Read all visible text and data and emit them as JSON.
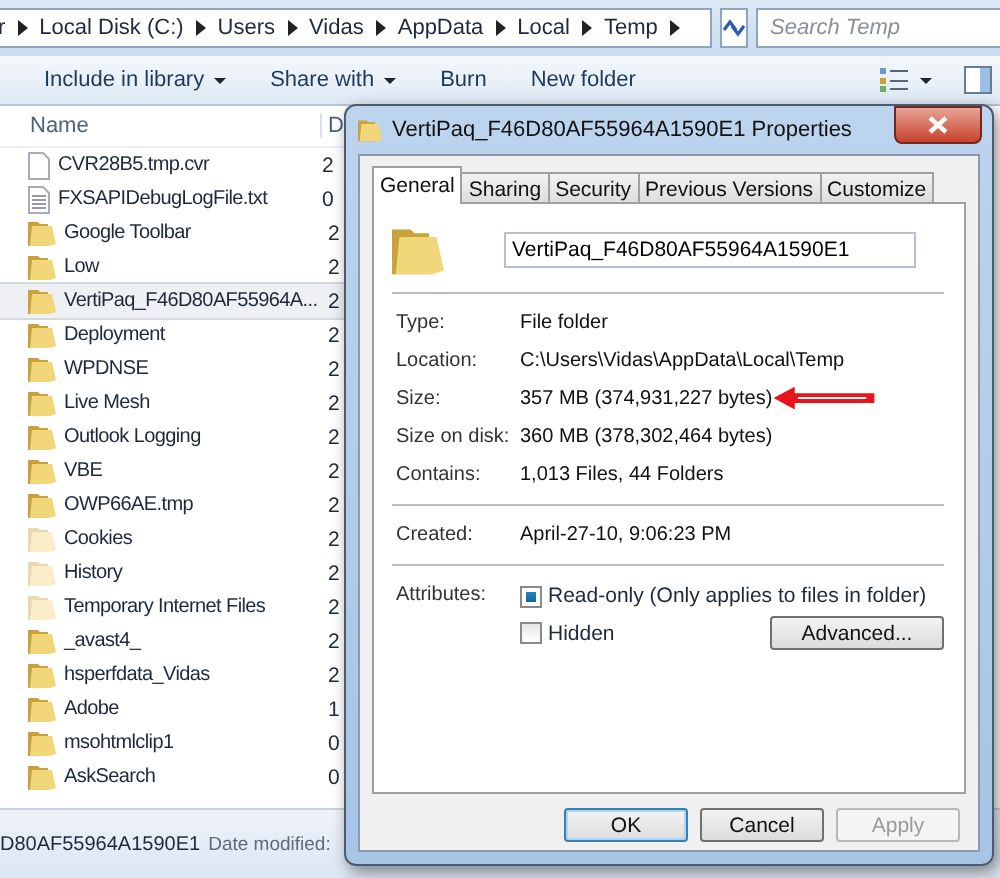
{
  "address_bar": {
    "crumbs": [
      "r",
      "Local Disk (C:)",
      "Users",
      "Vidas",
      "AppData",
      "Local",
      "Temp"
    ],
    "search": {
      "placeholder": "Search Temp"
    }
  },
  "toolbar": {
    "buttons": [
      {
        "label": "Include in library",
        "dropdown": true
      },
      {
        "label": "Share with",
        "dropdown": true
      },
      {
        "label": "Burn",
        "dropdown": false
      },
      {
        "label": "New folder",
        "dropdown": false
      }
    ]
  },
  "file_list": {
    "columns": [
      "Name",
      "D"
    ],
    "rows": [
      {
        "name": "CVR28B5.tmp.cvr",
        "kind": "file",
        "column_2": "2",
        "selected": false
      },
      {
        "name": "FXSAPIDebugLogFile.txt",
        "kind": "textfile",
        "column_2": "0",
        "selected": false
      },
      {
        "name": "Google Toolbar",
        "kind": "folder",
        "column_2": "2",
        "selected": false
      },
      {
        "name": "Low",
        "kind": "folder",
        "column_2": "2",
        "selected": false
      },
      {
        "name": "VertiPaq_F46D80AF55964A...",
        "kind": "folder",
        "column_2": "2",
        "selected": true
      },
      {
        "name": "Deployment",
        "kind": "folder",
        "column_2": "2",
        "selected": false
      },
      {
        "name": "WPDNSE",
        "kind": "folder",
        "column_2": "2",
        "selected": false
      },
      {
        "name": "Live Mesh",
        "kind": "folder",
        "column_2": "2",
        "selected": false
      },
      {
        "name": "Outlook Logging",
        "kind": "folder",
        "column_2": "2",
        "selected": false
      },
      {
        "name": "VBE",
        "kind": "folder",
        "column_2": "2",
        "selected": false
      },
      {
        "name": "OWP66AE.tmp",
        "kind": "folder",
        "column_2": "2",
        "selected": false
      },
      {
        "name": "Cookies",
        "kind": "system-folder",
        "column_2": "2",
        "selected": false
      },
      {
        "name": "History",
        "kind": "system-folder",
        "column_2": "2",
        "selected": false
      },
      {
        "name": "Temporary Internet Files",
        "kind": "system-folder",
        "column_2": "2",
        "selected": false
      },
      {
        "name": "_avast4_",
        "kind": "folder",
        "column_2": "2",
        "selected": false
      },
      {
        "name": "hsperfdata_Vidas",
        "kind": "folder",
        "column_2": "2",
        "selected": false
      },
      {
        "name": "Adobe",
        "kind": "folder",
        "column_2": "1",
        "selected": false
      },
      {
        "name": "msohtmlclip1",
        "kind": "folder",
        "column_2": "0",
        "selected": false
      },
      {
        "name": "AskSearch",
        "kind": "folder",
        "column_2": "0",
        "selected": false
      }
    ]
  },
  "status_bar": {
    "name": "D80AF55964A1590E1",
    "label": "Date modified:"
  },
  "dialog": {
    "title": "VertiPaq_F46D80AF55964A1590E1 Properties",
    "tabs": [
      {
        "label": "General",
        "selected": true
      },
      {
        "label": "Sharing",
        "selected": false
      },
      {
        "label": "Security",
        "selected": false
      },
      {
        "label": "Previous Versions",
        "selected": false
      },
      {
        "label": "Customize",
        "selected": false
      }
    ],
    "name_field": {
      "value": "VertiPaq_F46D80AF55964A1590E1"
    },
    "groups": [
      [
        {
          "label": "Type:",
          "value": "File folder"
        },
        {
          "label": "Location:",
          "value": "C:\\Users\\Vidas\\AppData\\Local\\Temp"
        },
        {
          "label": "Size:",
          "value": "357 MB (374,931,227 bytes)"
        },
        {
          "label": "Size on disk:",
          "value": "360 MB (378,302,464 bytes)"
        },
        {
          "label": "Contains:",
          "value": "1,013 Files, 44 Folders"
        }
      ],
      [
        {
          "label": "Created:",
          "value": "April-27-10, 9:06:23 PM"
        }
      ]
    ],
    "attributes": {
      "label": "Attributes:",
      "checkboxes": [
        {
          "label": "Read-only (Only applies to files in folder)",
          "checked": true
        },
        {
          "label": "Hidden",
          "checked": false
        }
      ],
      "advanced_button": "Advanced..."
    },
    "buttons": [
      {
        "label": "OK",
        "disabled": false,
        "default": true
      },
      {
        "label": "Cancel",
        "disabled": false,
        "default": false
      },
      {
        "label": "Apply",
        "disabled": true,
        "default": false
      }
    ]
  }
}
